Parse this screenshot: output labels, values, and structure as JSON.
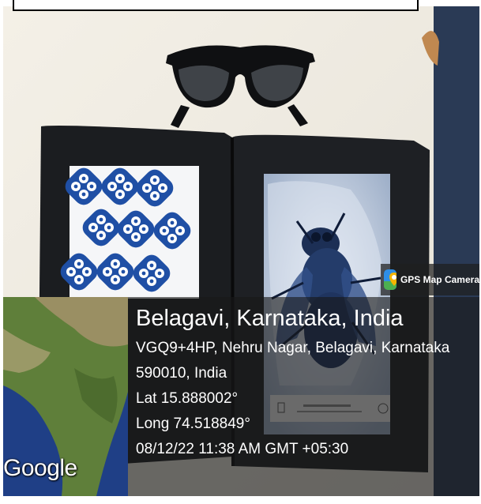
{
  "badge": {
    "label": "GPS Map Camera",
    "icon": "gps-map-camera-app-icon"
  },
  "map": {
    "logo_text": "Google"
  },
  "location": {
    "title": "Belagavi, Karnataka, India",
    "address_line1": "VGQ9+4HP, Nehru Nagar, Belagavi, Karnataka",
    "address_line2": "590010, India",
    "lat": "Lat 15.888002°",
    "long": "Long 74.518849°",
    "datetime": "08/12/22 11:38 AM GMT +05:30"
  },
  "colors": {
    "overlay": "#191919",
    "ocean": "#1f3f86",
    "land": "#5f7f3a",
    "wall": "#f0ece3",
    "case": "#1d1f22",
    "glyph_blue": "#1f4fa5"
  }
}
